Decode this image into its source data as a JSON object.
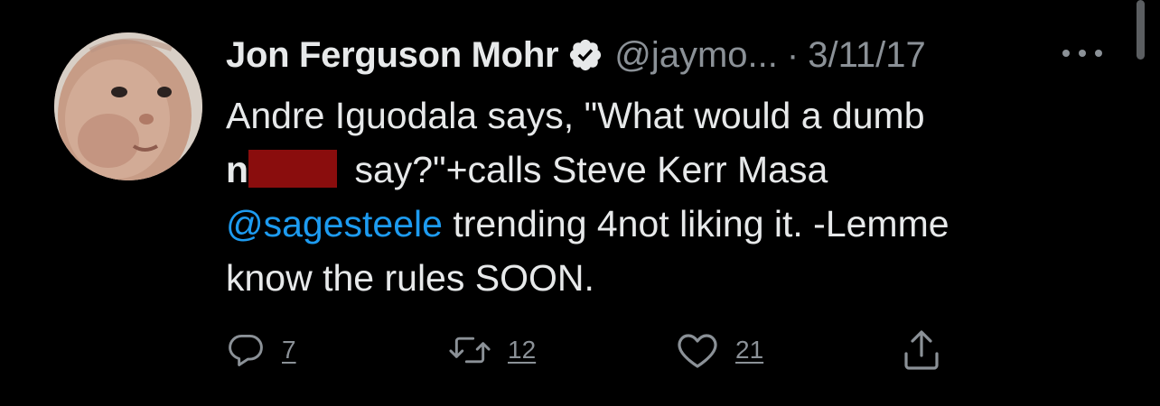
{
  "tweet": {
    "author": {
      "display_name": "Jon Ferguson Mohr",
      "handle": "@jaymo...",
      "verified": true,
      "avatar_icon": "baby-photo-avatar"
    },
    "separator": "·",
    "date": "3/11/17",
    "more_icon": "more-horizontal-icon",
    "text": {
      "line1": "Andre Iguodala says, \"What would a dumb",
      "line2_prefix": "n",
      "line2_rest": " say?\"+calls Steve Kerr Masa",
      "mention": "@sagesteele",
      "line3_rest": " trending 4not liking it. -Lemme",
      "line4": "know the rules SOON."
    },
    "actions": {
      "reply": {
        "icon": "reply-icon",
        "count": "7"
      },
      "retweet": {
        "icon": "retweet-icon",
        "count": "12"
      },
      "like": {
        "icon": "heart-icon",
        "count": "21"
      },
      "share": {
        "icon": "share-icon"
      }
    }
  },
  "colors": {
    "background": "#000000",
    "text_primary": "#e7e9ea",
    "text_secondary": "#8b9197",
    "link": "#1d9bf0",
    "redaction": "#8a0d0d"
  }
}
